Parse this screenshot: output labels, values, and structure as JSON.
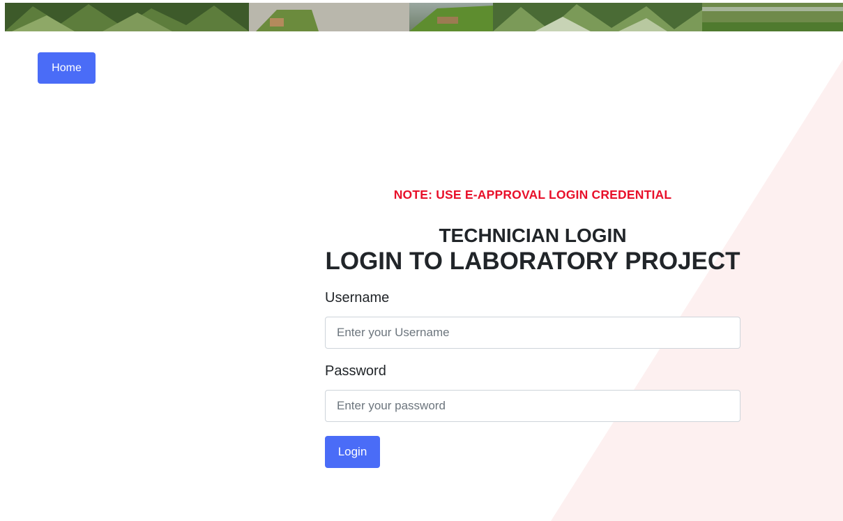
{
  "nav": {
    "home_label": "Home"
  },
  "login": {
    "note": "NOTE: USE E-APPROVAL LOGIN CREDENTIAL",
    "subtitle": "TECHNICIAN LOGIN",
    "title": "LOGIN TO LABORATORY PROJECT",
    "username_label": "Username",
    "username_placeholder": "Enter your Username",
    "password_label": "Password",
    "password_placeholder": "Enter your password",
    "submit_label": "Login"
  },
  "colors": {
    "primary": "#4a6cf7",
    "note": "#e8102a",
    "diagonal_bg": "#fdeeee"
  }
}
